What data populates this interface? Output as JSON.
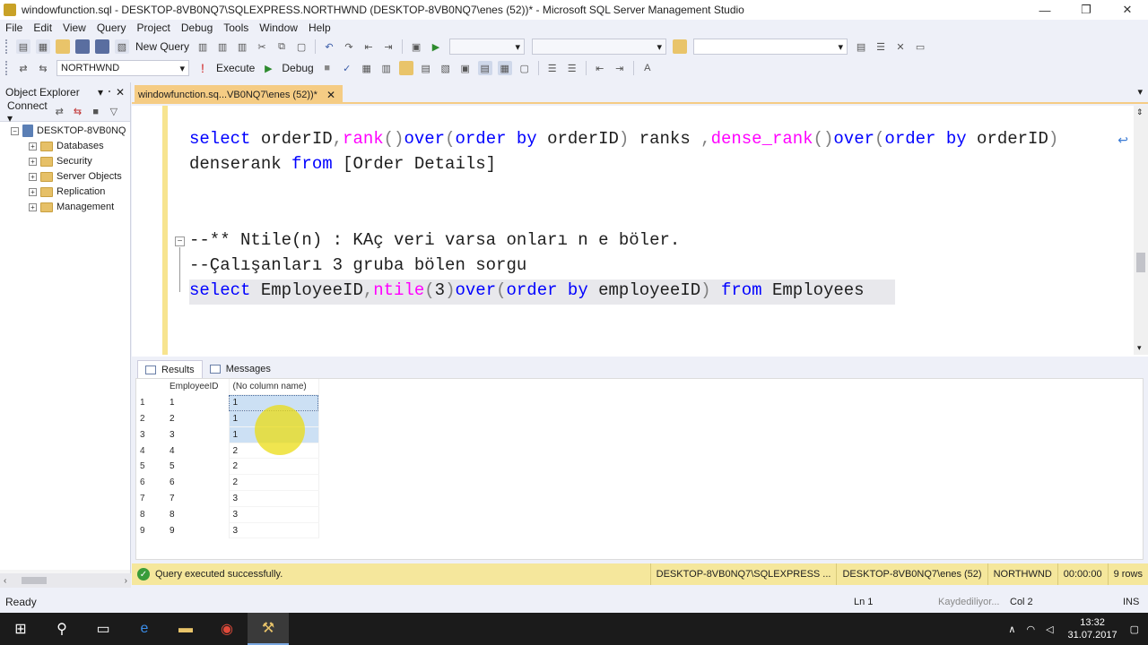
{
  "window": {
    "title": "windowfunction.sql - DESKTOP-8VB0NQ7\\SQLEXPRESS.NORTHWND (DESKTOP-8VB0NQ7\\enes (52))* - Microsoft SQL Server Management Studio",
    "min": "—",
    "max": "❐",
    "close": "✕"
  },
  "menu": [
    "File",
    "Edit",
    "View",
    "Query",
    "Project",
    "Debug",
    "Tools",
    "Window",
    "Help"
  ],
  "toolbar1": {
    "new_query": "New Query"
  },
  "toolbar2": {
    "database": "NORTHWND",
    "execute": "Execute",
    "debug": "Debug"
  },
  "object_explorer": {
    "title": "Object Explorer",
    "pin": "▾ ᛫ ✕",
    "connect": "Connect ▾",
    "server": "DESKTOP-8VB0NQ",
    "folders": [
      "Databases",
      "Security",
      "Server Objects",
      "Replication",
      "Management"
    ]
  },
  "tab": {
    "label": "windowfunction.sq...VB0NQ7\\enes (52))*",
    "close": "✕"
  },
  "editor": {
    "line1": {
      "t1": "select",
      "t2": " orderID",
      "t3": ",",
      "t4": "rank",
      "t5": "()",
      "t6": "over",
      "t7": "(",
      "t8": "order by",
      "t9": " orderID",
      "t10": ")",
      "t11": " ranks ",
      "t12": ",",
      "t13": "dense_rank",
      "t14": "()",
      "t15": "over",
      "t16": "(",
      "t17": "order by",
      "t18": " orderID",
      "t19": ")"
    },
    "line2": {
      "t1": "denserank ",
      "t2": "from",
      "t3": " [Order Details]"
    },
    "line3": "--** Ntile(n) : KAç veri varsa onları n e böler.",
    "line4": "--Çalışanları 3 gruba bölen sorgu",
    "line5": {
      "t1": "select",
      "t2": " EmployeeID",
      "t3": ",",
      "t4": "ntile",
      "t5": "(",
      "t6": "3",
      "t7": ")",
      "t8": "over",
      "t9": "(",
      "t10": "order by",
      "t11": " employeeID",
      "t12": ")",
      "t13": " from",
      "t14": " Employees"
    },
    "wrap_glyph": "↩",
    "fold_glyph": "−"
  },
  "results_tabs": {
    "results": "Results",
    "messages": "Messages"
  },
  "grid": {
    "columns": [
      "EmployeeID",
      "(No column name)"
    ],
    "rows": [
      {
        "n": "1",
        "id": "1",
        "v": "1"
      },
      {
        "n": "2",
        "id": "2",
        "v": "1"
      },
      {
        "n": "3",
        "id": "3",
        "v": "1"
      },
      {
        "n": "4",
        "id": "4",
        "v": "2"
      },
      {
        "n": "5",
        "id": "5",
        "v": "2"
      },
      {
        "n": "6",
        "id": "6",
        "v": "2"
      },
      {
        "n": "7",
        "id": "7",
        "v": "3"
      },
      {
        "n": "8",
        "id": "8",
        "v": "3"
      },
      {
        "n": "9",
        "id": "9",
        "v": "3"
      }
    ]
  },
  "exec_status": {
    "message": "Query executed successfully.",
    "server": "DESKTOP-8VB0NQ7\\SQLEXPRESS ...",
    "user": "DESKTOP-8VB0NQ7\\enes (52)",
    "db": "NORTHWND",
    "time": "00:00:00",
    "rows": "9 rows"
  },
  "statusbar": {
    "ready": "Ready",
    "ln": "Ln 1",
    "saving": "Kaydediliyor...",
    "col": "Col 2",
    "ins": "INS"
  },
  "taskbar": {
    "time": "13:32",
    "date": "31.07.2017"
  },
  "colors": {
    "accent_tab": "#f5cc84",
    "exec_bar": "#f5e79c",
    "keyword": "#0000ff",
    "function": "#ff00ff",
    "comment": "#008000",
    "selection": "#cce0f4"
  }
}
